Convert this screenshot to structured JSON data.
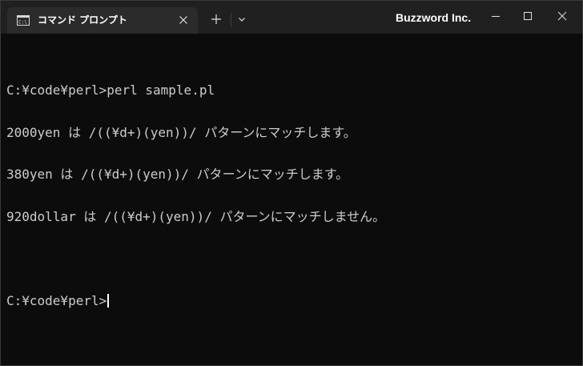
{
  "titlebar": {
    "tab": {
      "icon": "terminal-icon",
      "title": "コマンド プロンプト",
      "close_icon": "close-icon"
    },
    "new_tab_icon": "plus-icon",
    "dropdown_icon": "chevron-down-icon",
    "brand": "Buzzword Inc.",
    "window_controls": [
      "minimize-icon",
      "maximize-icon",
      "close-icon"
    ]
  },
  "terminal": {
    "lines": [
      "C:¥code¥perl>perl sample.pl",
      "2000yen は /((¥d+)(yen))/ パターンにマッチします。",
      "380yen は /((¥d+)(yen))/ パターンにマッチします。",
      "920dollar は /((¥d+)(yen))/ パターンにマッチしません。",
      "",
      "C:¥code¥perl>"
    ]
  },
  "colors": {
    "titlebar_bg": "#202020",
    "tab_bg": "#2b2b2b",
    "terminal_bg": "#0c0c0c",
    "terminal_text": "#cccccc"
  }
}
